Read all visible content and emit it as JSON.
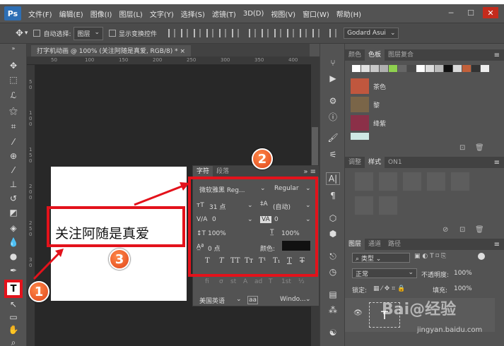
{
  "app": {
    "logo": "Ps"
  },
  "menu": [
    "文件(F)",
    "编辑(E)",
    "图像(I)",
    "图层(L)",
    "文字(Y)",
    "选择(S)",
    "滤镜(T)",
    "3D(D)",
    "视图(V)",
    "窗口(W)",
    "帮助(H)"
  ],
  "options": {
    "auto_select_label": "自动选择:",
    "auto_select_value": "图层",
    "show_transform_label": "显示变换控件",
    "font_preview": "Godard Asui"
  },
  "document": {
    "tab_title": "打字机动画 @ 100% (关注阿随是真爱, RGB/8) *",
    "canvas_text": "关注阿随是真爱"
  },
  "ruler": {
    "h": [
      "50",
      "100",
      "150",
      "200",
      "250",
      "300",
      "350",
      "400"
    ],
    "v": [
      "5",
      "0",
      "1",
      "0",
      "0",
      "1",
      "5",
      "0",
      "2",
      "0",
      "0",
      "2",
      "5",
      "0",
      "3",
      "0"
    ]
  },
  "char_panel": {
    "tab_char": "字符",
    "tab_para": "段落",
    "font_family": "微软雅黑 Reg...",
    "font_style": "Regular",
    "font_size": "31 点",
    "leading": "(自动)",
    "kerning": "0",
    "tracking": "0",
    "v_scale": "100%",
    "h_scale": "100%",
    "baseline": "0 点",
    "color_label": "颜色:",
    "language": "美国英语",
    "aa_label": "aa",
    "aa_value": "Windo...",
    "type_buttons": [
      "T",
      "T",
      "TT",
      "Tт",
      "T¹",
      "T₁",
      "T",
      "T"
    ],
    "glyph_row": [
      "fi",
      "σ",
      "st",
      "A",
      "ad",
      "T",
      "1st",
      "½"
    ]
  },
  "color_panel": {
    "tabs": [
      "颜色",
      "色板",
      "图层复合"
    ],
    "swatches": [
      "#ffffff",
      "#e0e0e0",
      "#c8c8c8",
      "#b0b0b0",
      "#8fd14f",
      "#666666",
      "#4a4a4a",
      "#ffffff",
      "#dddddd",
      "#bbbbbb",
      "#111111",
      "#d9d9d9",
      "#c2603a",
      "#333333",
      "#eeeeee"
    ]
  },
  "library": [
    {
      "name": "茶色",
      "color": "#c0573e"
    },
    {
      "name": "黎",
      "color": "#7a6548"
    },
    {
      "name": "绛紫",
      "color": "#8b3048"
    },
    {
      "name": "",
      "color": "#cfe8e4"
    }
  ],
  "adjust_panel": {
    "tabs": [
      "调整",
      "样式",
      "ON1"
    ]
  },
  "layers_panel": {
    "tabs": [
      "图层",
      "通道",
      "路径"
    ],
    "kind": "类型",
    "blend": "正常",
    "opacity_label": "不透明度:",
    "opacity": "100%",
    "lock_label": "锁定:",
    "fill_label": "填充:",
    "fill": "100%"
  },
  "badges": [
    "1",
    "2",
    "3"
  ],
  "watermark": {
    "line1": "Bai@经验",
    "line2": "jingyan.baidu.com"
  }
}
